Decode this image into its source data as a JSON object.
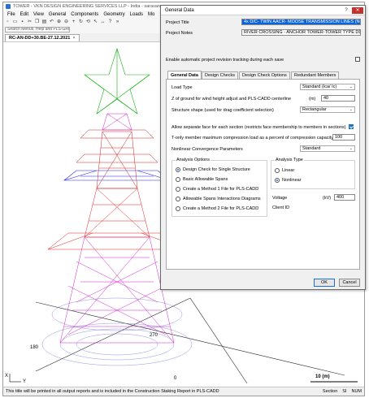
{
  "app": {
    "title": "TOWER - VKN DESIGN ENGINEERING SERVICES LLP - India - saravanan",
    "menus": [
      "File",
      "Edit",
      "View",
      "General",
      "Components",
      "Geometry",
      "Loads",
      "Mo"
    ],
    "search_placeholder": "Search Menus, Help and PLS-GRID",
    "doc_tab": "RC-AN-DD+30.BE-27.12.2021",
    "doc_tab_close": "×",
    "toolbar_icons": [
      "new-icon",
      "open-icon",
      "save-icon",
      "cut-icon",
      "copy-icon",
      "paste-icon",
      "undo-icon",
      "zoom-in-icon",
      "zoom-out-icon",
      "pan-icon",
      "refresh-icon",
      "rotate-icon",
      "select-icon",
      "measure-icon",
      "help-icon",
      "chevron-icon"
    ]
  },
  "viewport": {
    "axis_labels": [
      "180",
      "270",
      "0"
    ],
    "axis_x": "X",
    "axis_y": "Y",
    "scale_label": "10 (m)"
  },
  "status": {
    "message": "This title will be printed in all output reports and is included in the Construction Staking Report in PLS-CADD",
    "section": "Section",
    "units": "SI",
    "num": "NUM"
  },
  "dialog": {
    "title": "General Data",
    "help_btn": "?",
    "close_btn": "✕",
    "project_title_label": "Project Title",
    "project_title_value": "4x D/C- TWIN AACR- MOOSE TRANSMISSION LINES (NO.5)",
    "project_notes_label": "Project Notes",
    "project_notes_value": "RIVER CROSSING - ANCHOR TOWER-TOWER TYPE DD (D",
    "revision_tracking_label": "Enable automatic project revision tracking during each save",
    "tabs": [
      "General Data",
      "Design Checks",
      "Design Check Options",
      "Redundant Members"
    ],
    "load_type_label": "Load Type",
    "load_type_value": "Standard (Ica/ Ic)",
    "z_height_label": "Z of ground for wind height adjust and PLS-CADD centerline",
    "z_height_unit": "(m)",
    "z_height_value": "40",
    "structure_shape_label": "Structure shape (used for drag coefficient selection)",
    "structure_shape_value": "Rectangular",
    "separate_face_label": "Allow separate face for each section (restricts face membership to members in sections)",
    "tonly_label": "T-only member maximum compression load as a percent of compression capacity",
    "tonly_value": "100",
    "nonlinear_label": "Nonlinear Convergence Parameters",
    "nonlinear_value": "Standard",
    "analysis_options_title": "Analysis Options",
    "analysis_options": [
      "Design Check for Single Structure",
      "Basic Allowable Spans",
      "Create a Method 1 File for PLS-CADD",
      "Allowable Spans Interactions Diagrams",
      "Create a Method 2 File for PLS-CADD"
    ],
    "analysis_type_title": "Analysis Type",
    "analysis_types": [
      "Linear",
      "Nonlinear"
    ],
    "voltage_label": "Voltage",
    "voltage_unit": "(kV)",
    "voltage_value": "400",
    "client_id_label": "Client ID",
    "ok": "OK",
    "cancel": "Cancel"
  }
}
